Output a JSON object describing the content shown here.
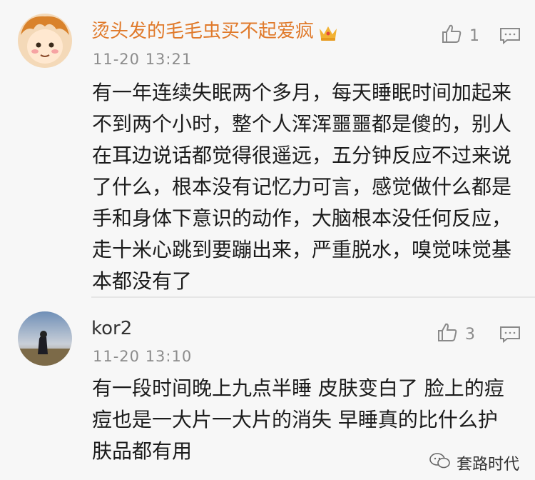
{
  "comments": [
    {
      "username": "烫头发的毛毛虫买不起爱疯",
      "time": "11-20 13:21",
      "likes": "1",
      "text": "有一年连续失眠两个多月，每天睡眠时间加起来不到两个小时，整个人浑浑噩噩都是傻的，别人在耳边说话都觉得很遥远，五分钟反应不过来说了什么，根本没有记忆力可言，感觉做什么都是手和身体下意识的动作，大脑根本没任何反应，走十米心跳到要蹦出来，严重脱水，嗅觉味觉基本都没有了"
    },
    {
      "username": "kor2",
      "time": "11-20 13:10",
      "likes": "3",
      "text": "有一段时间晚上九点半睡 皮肤变白了 脸上的痘痘也是一大片一大片的消失 早睡真的比什么护肤品都有用"
    }
  ],
  "watermark": "套路时代",
  "colors": {
    "username1": "#e07a2b",
    "meta": "#8c8c8c",
    "background": "#f7f7f7"
  },
  "icons": [
    "crown-icon",
    "like-thumb-icon",
    "reply-icon",
    "wechat-icon"
  ]
}
